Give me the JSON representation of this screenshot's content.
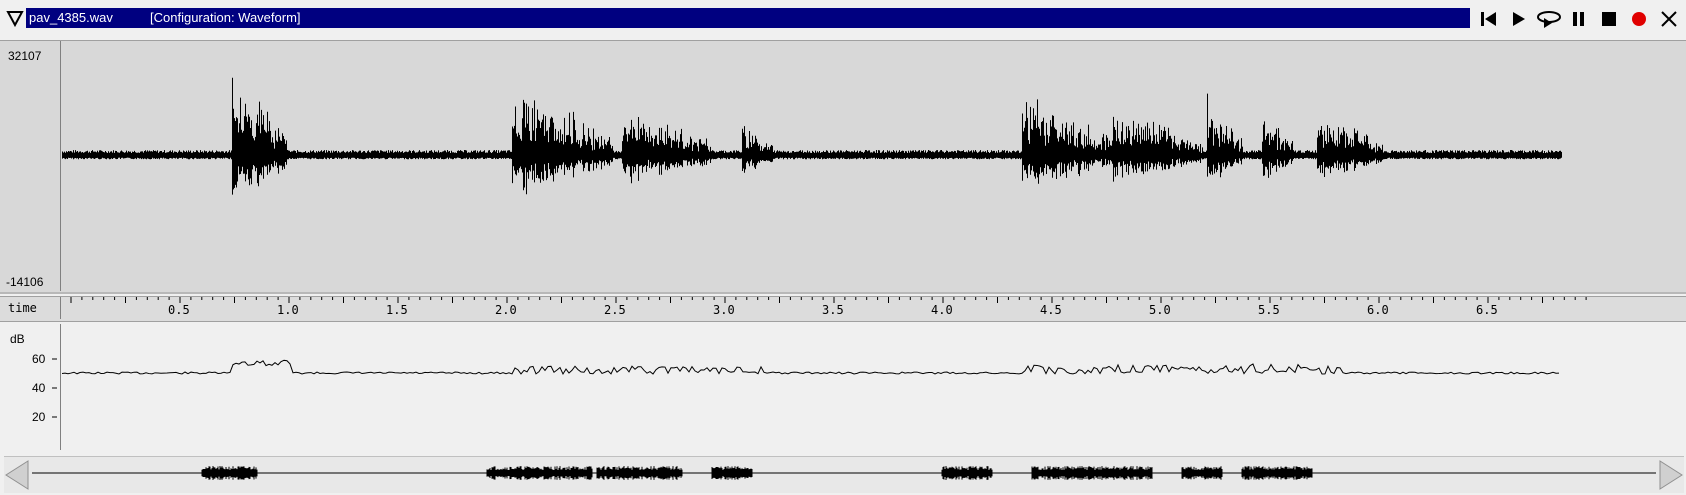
{
  "window": {
    "menu_icon": "triangle-down-icon",
    "file_name": "pav_4385.wav",
    "configuration": "[Configuration: Waveform]"
  },
  "toolbar": {
    "buttons": [
      {
        "name": "skip-to-start-button",
        "icon": "skip-start-icon"
      },
      {
        "name": "play-button",
        "icon": "play-icon"
      },
      {
        "name": "play-loop-button",
        "icon": "loop-play-icon"
      },
      {
        "name": "pause-button",
        "icon": "pause-icon"
      },
      {
        "name": "stop-button",
        "icon": "stop-icon"
      },
      {
        "name": "record-button",
        "icon": "record-icon",
        "color": "#e00000"
      },
      {
        "name": "close-button",
        "icon": "close-icon"
      }
    ]
  },
  "waveform": {
    "y_max": "32107",
    "y_min": "-14106"
  },
  "time_axis": {
    "label": "time",
    "ticks": [
      "0.5",
      "1.0",
      "1.5",
      "2.0",
      "2.5",
      "3.0",
      "3.5",
      "4.0",
      "4.5",
      "5.0",
      "5.5",
      "6.0",
      "6.5"
    ]
  },
  "level_panel": {
    "unit": "dB",
    "labels": [
      "60",
      "40",
      "20"
    ]
  },
  "overview_scroller": {
    "left_arrow_icon": "scroll-left-icon",
    "right_arrow_icon": "scroll-right-icon"
  }
}
